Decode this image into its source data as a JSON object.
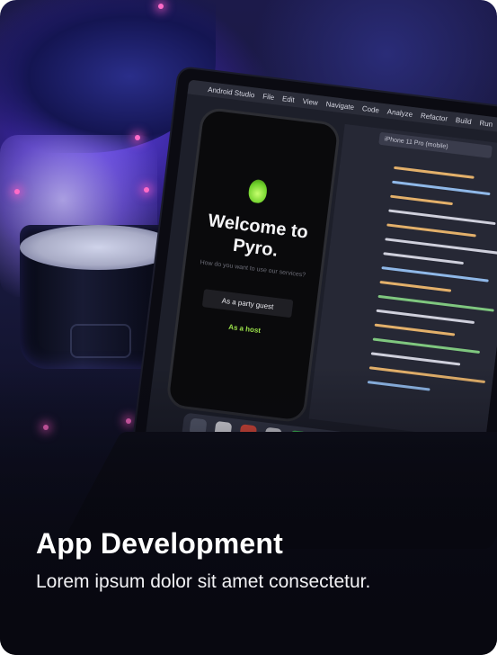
{
  "card": {
    "title": "App Development",
    "subtitle": "Lorem ipsum dolor sit amet consectetur."
  },
  "photo": {
    "menubar": [
      "Android Studio",
      "File",
      "Edit",
      "View",
      "Navigate",
      "Code",
      "Analyze",
      "Refactor",
      "Build",
      "Run"
    ],
    "device_tab": "iPhone 11 Pro (mobile)",
    "app_title": "Welcome to Pyro.",
    "app_question": "How do you want to use our services?",
    "app_button": "As a party guest",
    "app_link": "As a host"
  }
}
